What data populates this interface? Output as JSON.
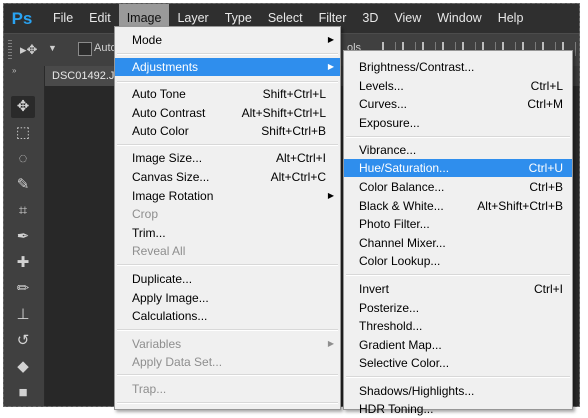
{
  "app": {
    "logo": "Ps"
  },
  "menubar": {
    "items": [
      "File",
      "Edit",
      "Image",
      "Layer",
      "Type",
      "Select",
      "Filter",
      "3D",
      "View",
      "Window",
      "Help"
    ],
    "active": "Image"
  },
  "options_bar": {
    "auto_select_label": "Auto-",
    "partial_label": "ols"
  },
  "document": {
    "tab_title": "DSC01492.JPG"
  },
  "image_menu": {
    "items": [
      {
        "label": "Mode",
        "shortcut": "",
        "submenu": true
      },
      {
        "label": "Adjustments",
        "shortcut": "",
        "submenu": true,
        "highlighted": true
      },
      {
        "label": "Auto Tone",
        "shortcut": "Shift+Ctrl+L"
      },
      {
        "label": "Auto Contrast",
        "shortcut": "Alt+Shift+Ctrl+L"
      },
      {
        "label": "Auto Color",
        "shortcut": "Shift+Ctrl+B"
      },
      {
        "label": "Image Size...",
        "shortcut": "Alt+Ctrl+I"
      },
      {
        "label": "Canvas Size...",
        "shortcut": "Alt+Ctrl+C"
      },
      {
        "label": "Image Rotation",
        "shortcut": "",
        "submenu": true
      },
      {
        "label": "Crop",
        "shortcut": "",
        "disabled": true
      },
      {
        "label": "Trim...",
        "shortcut": ""
      },
      {
        "label": "Reveal All",
        "shortcut": "",
        "disabled": true
      },
      {
        "label": "Duplicate...",
        "shortcut": ""
      },
      {
        "label": "Apply Image...",
        "shortcut": ""
      },
      {
        "label": "Calculations...",
        "shortcut": ""
      },
      {
        "label": "Variables",
        "shortcut": "",
        "submenu": true,
        "disabled": true
      },
      {
        "label": "Apply Data Set...",
        "shortcut": "",
        "disabled": true
      },
      {
        "label": "Trap...",
        "shortcut": "",
        "disabled": true
      }
    ]
  },
  "adjustments_menu": {
    "items": [
      {
        "label": "Brightness/Contrast...",
        "shortcut": ""
      },
      {
        "label": "Levels...",
        "shortcut": "Ctrl+L"
      },
      {
        "label": "Curves...",
        "shortcut": "Ctrl+M"
      },
      {
        "label": "Exposure...",
        "shortcut": ""
      },
      {
        "label": "Vibrance...",
        "shortcut": ""
      },
      {
        "label": "Hue/Saturation...",
        "shortcut": "Ctrl+U",
        "highlighted": true
      },
      {
        "label": "Color Balance...",
        "shortcut": "Ctrl+B"
      },
      {
        "label": "Black & White...",
        "shortcut": "Alt+Shift+Ctrl+B"
      },
      {
        "label": "Photo Filter...",
        "shortcut": ""
      },
      {
        "label": "Channel Mixer...",
        "shortcut": ""
      },
      {
        "label": "Color Lookup...",
        "shortcut": ""
      },
      {
        "label": "Invert",
        "shortcut": "Ctrl+I"
      },
      {
        "label": "Posterize...",
        "shortcut": ""
      },
      {
        "label": "Threshold...",
        "shortcut": ""
      },
      {
        "label": "Gradient Map...",
        "shortcut": ""
      },
      {
        "label": "Selective Color...",
        "shortcut": ""
      },
      {
        "label": "Shadows/Highlights...",
        "shortcut": ""
      },
      {
        "label": "HDR Toning...",
        "shortcut": ""
      }
    ]
  },
  "toolbox": {
    "tools": [
      "move-tool",
      "marquee-tool",
      "lasso-tool",
      "quick-selection-tool",
      "crop-tool",
      "eyedropper-tool",
      "healing-brush-tool",
      "brush-tool",
      "clone-stamp-tool",
      "history-brush-tool",
      "eraser-tool",
      "gradient-tool"
    ]
  },
  "colors": {
    "highlight": "#2f8eed",
    "menu_bg": "#f0f0f0",
    "app_dark": "#2f2f2f",
    "logo": "#29a3f2"
  }
}
